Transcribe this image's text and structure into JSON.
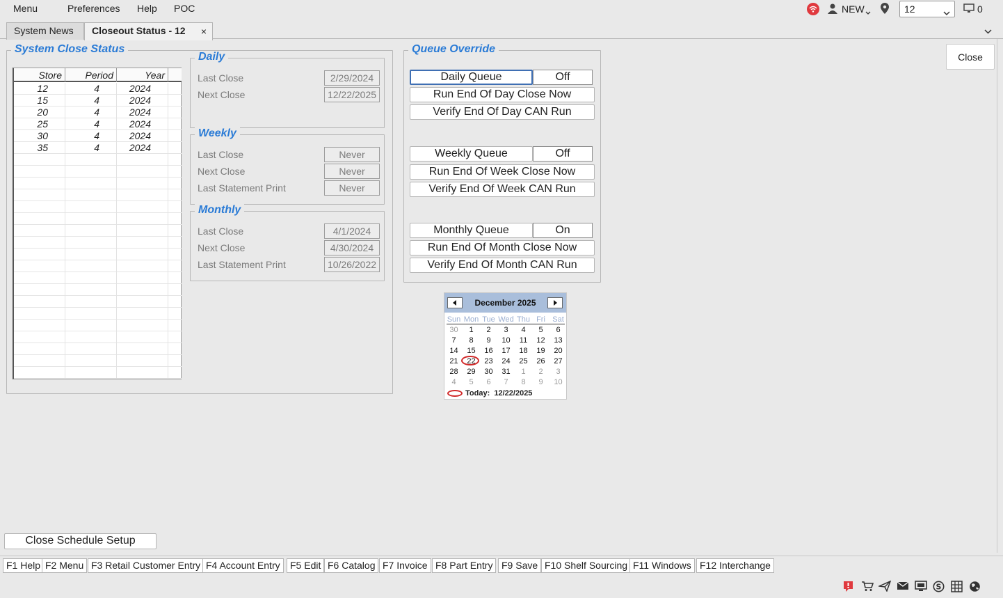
{
  "menubar": {
    "items": [
      "Menu",
      "Preferences",
      "Help",
      "POC"
    ],
    "user_label": "NEW",
    "store_value": "12",
    "monitor_count": "0"
  },
  "tabs": [
    {
      "label": "System News",
      "active": false
    },
    {
      "label": "Closeout Status - 12",
      "active": true,
      "close": "×"
    }
  ],
  "system_close_status": {
    "title": "System Close Status",
    "columns": [
      "Store",
      "Period",
      "Year"
    ],
    "rows": [
      [
        "12",
        "4",
        "2024"
      ],
      [
        "15",
        "4",
        "2024"
      ],
      [
        "20",
        "4",
        "2024"
      ],
      [
        "25",
        "4",
        "2024"
      ],
      [
        "30",
        "4",
        "2024"
      ],
      [
        "35",
        "4",
        "2024"
      ]
    ]
  },
  "daily": {
    "title": "Daily",
    "last_close_label": "Last Close",
    "last_close": "2/29/2024",
    "next_close_label": "Next Close",
    "next_close": "12/22/2025"
  },
  "weekly": {
    "title": "Weekly",
    "last_close_label": "Last Close",
    "last_close": "Never",
    "next_close_label": "Next Close",
    "next_close": "Never",
    "last_statement_label": "Last Statement Print",
    "last_statement": "Never"
  },
  "monthly": {
    "title": "Monthly",
    "last_close_label": "Last Close",
    "last_close": "4/1/2024",
    "next_close_label": "Next Close",
    "next_close": "4/30/2024",
    "last_statement_label": "Last Statement Print",
    "last_statement": "10/26/2022"
  },
  "queue_override": {
    "title": "Queue Override",
    "daily_queue_label": "Daily Queue",
    "daily_queue_state": "Off",
    "run_eod_label": "Run End Of Day Close Now",
    "verify_eod_label": "Verify End Of Day CAN Run",
    "weekly_queue_label": "Weekly Queue",
    "weekly_queue_state": "Off",
    "run_eow_label": "Run End Of Week Close Now",
    "verify_eow_label": "Verify End Of Week CAN Run",
    "monthly_queue_label": "Monthly Queue",
    "monthly_queue_state": "On",
    "run_eom_label": "Run End Of Month Close Now",
    "verify_eom_label": "Verify End Of Month CAN Run"
  },
  "close_button": "Close",
  "calendar": {
    "month_label": "December 2025",
    "weekdays": [
      "Sun",
      "Mon",
      "Tue",
      "Wed",
      "Thu",
      "Fri",
      "Sat"
    ],
    "weeks": [
      [
        "30",
        "1",
        "2",
        "3",
        "4",
        "5",
        "6"
      ],
      [
        "7",
        "8",
        "9",
        "10",
        "11",
        "12",
        "13"
      ],
      [
        "14",
        "15",
        "16",
        "17",
        "18",
        "19",
        "20"
      ],
      [
        "21",
        "22",
        "23",
        "24",
        "25",
        "26",
        "27"
      ],
      [
        "28",
        "29",
        "30",
        "31",
        "1",
        "2",
        "3"
      ],
      [
        "4",
        "5",
        "6",
        "7",
        "8",
        "9",
        "10"
      ]
    ],
    "selected_day": "22",
    "today_label": "Today:",
    "today_value": "12/22/2025"
  },
  "close_schedule_setup": "Close Schedule Setup",
  "fkeys": [
    "F1 Help",
    "F2 Menu",
    "F3 Retail Customer Entry",
    "F4 Account Entry",
    "F5 Edit",
    "F6 Catalog",
    "F7 Invoice",
    "F8 Part Entry",
    "F9 Save",
    "F10 Shelf Sourcing",
    "F11 Windows",
    "F12 Interchange"
  ],
  "status_icons": [
    "alert-icon",
    "cart-icon",
    "send-icon",
    "mail-icon",
    "monitor-icon",
    "dollar-icon",
    "grid-icon",
    "globe-icon"
  ],
  "colors": {
    "group_title": "#2a7bd6",
    "alert": "#e0393e",
    "calendar_header": "#a9bedb",
    "today_ring": "#d12a2a"
  }
}
